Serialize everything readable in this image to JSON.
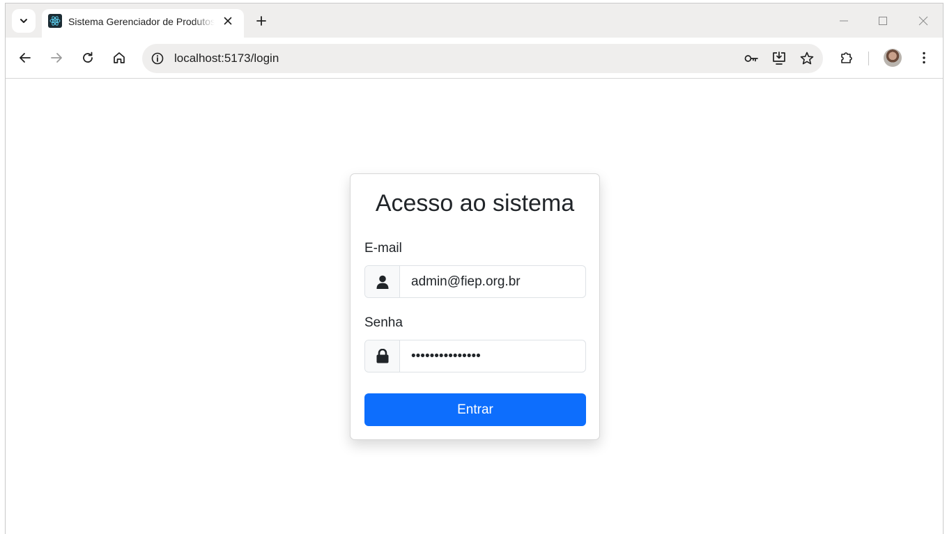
{
  "browser": {
    "tab": {
      "title": "Sistema Gerenciador de Produtos",
      "favicon": "react-icon"
    },
    "omnibox": {
      "url": "localhost:5173/login"
    },
    "icons": {
      "tab_search": "chevron-down-icon",
      "tab_close": "close-icon",
      "new_tab": "plus-icon",
      "minimize": "minimize-icon",
      "maximize": "maximize-icon",
      "close_window": "close-icon",
      "back": "arrow-left-icon",
      "forward": "arrow-right-icon",
      "reload": "reload-icon",
      "home": "home-icon",
      "site_info": "info-icon",
      "password": "key-icon",
      "install": "install-icon",
      "bookmark": "star-icon",
      "extensions": "puzzle-icon",
      "menu": "kebab-menu-icon"
    }
  },
  "login": {
    "title": "Acesso ao sistema",
    "email_label": "E-mail",
    "email_value": "admin@fiep.org.br",
    "password_label": "Senha",
    "password_value": "•••••••••••••••",
    "submit_label": "Entrar"
  },
  "colors": {
    "primary": "#0d6efd",
    "text": "#212529",
    "addon_bg": "#f8f9fa",
    "border": "#dee2e6"
  }
}
